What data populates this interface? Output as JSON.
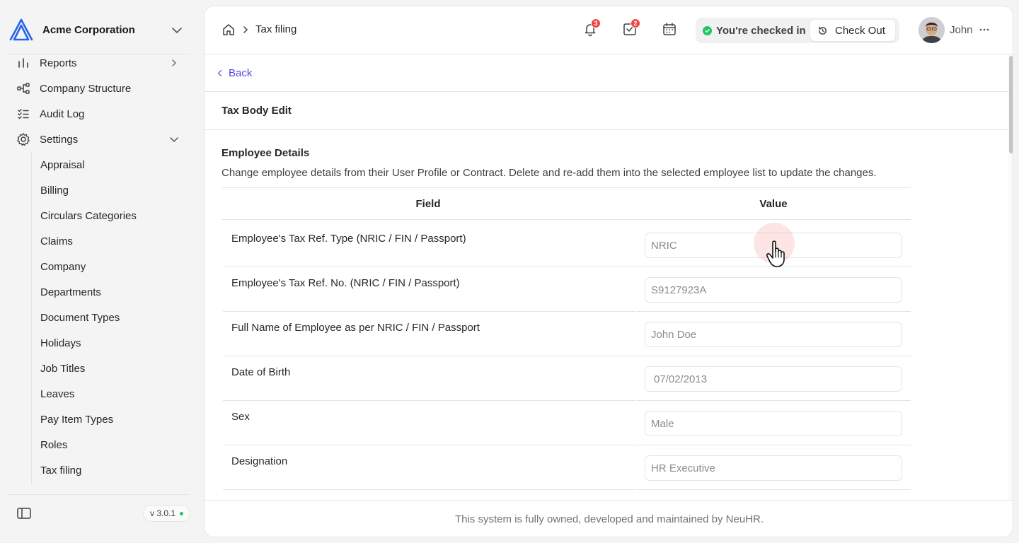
{
  "colors": {
    "accent": "#4f46e5",
    "logo": "#2563eb",
    "badge": "#ef4444",
    "checked_in": "#22c55e",
    "border": "#e4e4e7"
  },
  "org": {
    "name": "Acme Corporation",
    "logo_icon": "acme-logo-icon"
  },
  "sidebar": {
    "nav": [
      {
        "label": "Reports",
        "icon": "reports-icon"
      },
      {
        "label": "Company Structure",
        "icon": "company-structure-icon"
      },
      {
        "label": "Audit Log",
        "icon": "audit-log-icon"
      },
      {
        "label": "Settings",
        "icon": "gear-icon"
      }
    ],
    "settings_items": [
      "Appraisal",
      "Billing",
      "Circulars Categories",
      "Claims",
      "Company",
      "Departments",
      "Document Types",
      "Holidays",
      "Job Titles",
      "Leaves",
      "Pay Item Types",
      "Roles",
      "Tax filing"
    ],
    "version": "v 3.0.1"
  },
  "header": {
    "breadcrumb": "Tax filing",
    "notifications_count": "3",
    "tasks_count": "2",
    "checkin_status": "You're checked in",
    "checkout_label": "Check Out",
    "user_name": "John"
  },
  "page": {
    "back_label": "Back",
    "title": "Tax Body Edit",
    "section_title": "Employee Details",
    "section_desc": "Change employee details from their User Profile or Contract. Delete and re-add them into the selected employee list to update the changes.",
    "table": {
      "headers": {
        "field": "Field",
        "value": "Value"
      },
      "rows": [
        {
          "label": "Employee's Tax Ref. Type (NRIC / FIN / Passport)",
          "value": "NRIC"
        },
        {
          "label": "Employee's Tax Ref. No. (NRIC / FIN / Passport)",
          "value": "S9127923A"
        },
        {
          "label": "Full Name of Employee as per NRIC / FIN / Passport",
          "value": "John Doe"
        },
        {
          "label": "Date of Birth",
          "value": "07/02/2013"
        },
        {
          "label": "Sex",
          "value": "Male"
        },
        {
          "label": "Designation",
          "value": "HR Executive"
        }
      ]
    }
  },
  "footer": {
    "text": "This system is fully owned, developed and maintained by NeuHR."
  }
}
